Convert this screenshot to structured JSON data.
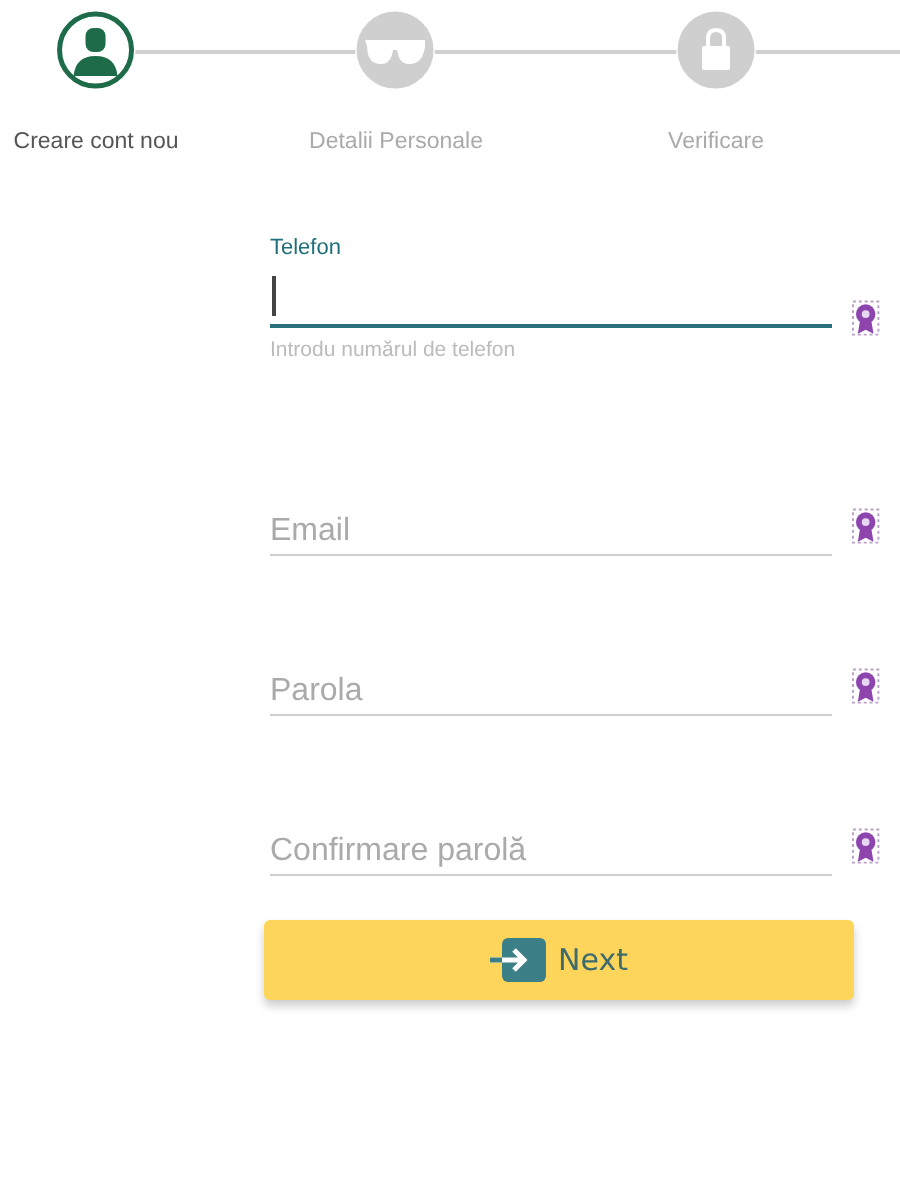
{
  "steps": [
    {
      "label": "Creare cont nou",
      "kind": "person",
      "selected": true
    },
    {
      "label": "Detalii Personale",
      "kind": "glasses",
      "selected": false
    },
    {
      "label": "Verificare",
      "kind": "lock",
      "selected": false
    }
  ],
  "fields": [
    {
      "label": "Telefon",
      "helper": "Introdu numărul de telefon",
      "focused": true
    },
    {
      "placeholder": "Email",
      "focused": false
    },
    {
      "placeholder": "Parola",
      "focused": false
    },
    {
      "placeholder": "Confirmare parolă",
      "focused": false
    }
  ],
  "next_button": {
    "label": "Next"
  }
}
